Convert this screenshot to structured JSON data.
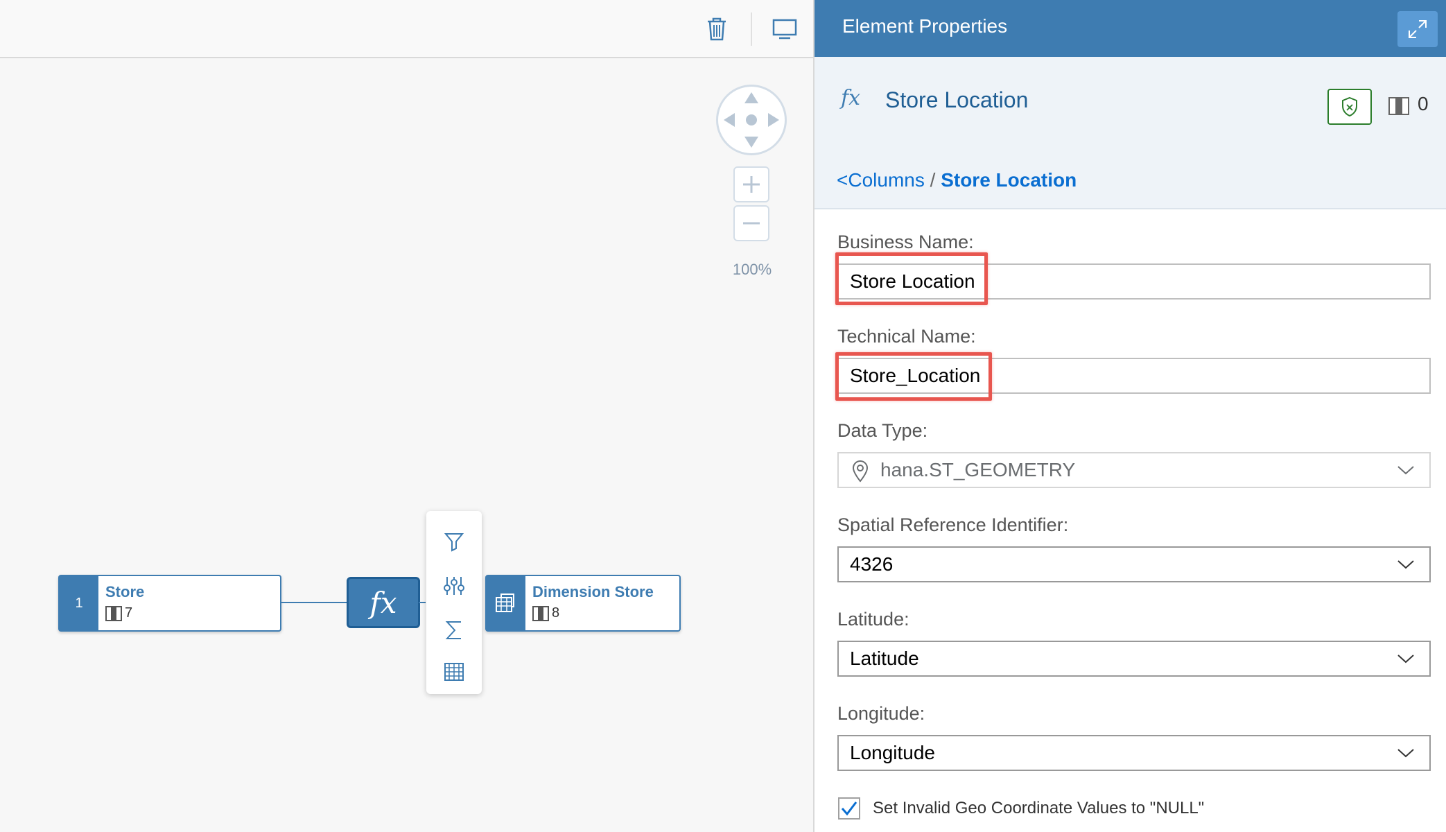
{
  "canvas": {
    "zoom_label": "100%",
    "nodes": {
      "source": {
        "index": "1",
        "title": "Store",
        "count": "7"
      },
      "target": {
        "title": "Dimension Store",
        "count": "8"
      }
    },
    "fx_label": "fx"
  },
  "panel": {
    "title": "Element Properties",
    "element": {
      "fx": "fx",
      "name": "Store Location",
      "column_count": "0"
    },
    "breadcrumb": {
      "back": "<Columns",
      "separator": " / ",
      "current": "Store Location"
    },
    "fields": {
      "business_name": {
        "label": "Business Name:",
        "value": "Store Location"
      },
      "technical_name": {
        "label": "Technical Name:",
        "value": "Store_Location"
      },
      "data_type": {
        "label": "Data Type:",
        "value": "hana.ST_GEOMETRY",
        "icon": "location-pin-icon"
      },
      "srid": {
        "label": "Spatial Reference Identifier:",
        "value": "4326"
      },
      "latitude": {
        "label": "Latitude:",
        "value": "Latitude"
      },
      "longitude": {
        "label": "Longitude:",
        "value": "Longitude"
      }
    },
    "checkbox": {
      "label": "Set Invalid Geo Coordinate Values to \"NULL\"",
      "checked": true
    }
  },
  "colors": {
    "accent": "#3e7cb1",
    "highlight": "#e8564f",
    "link": "#0a6ed1"
  }
}
